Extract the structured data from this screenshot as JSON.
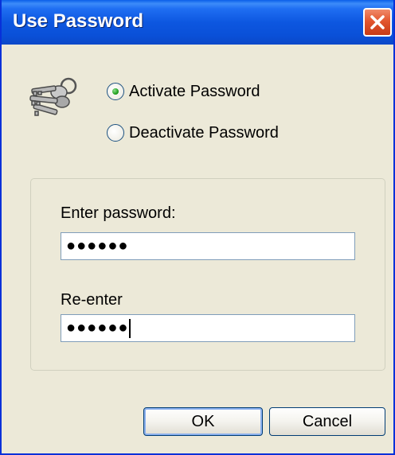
{
  "window": {
    "title": "Use Password"
  },
  "options": {
    "activate_label": "Activate Password",
    "deactivate_label": "Deactivate Password",
    "selected": "Activate Password"
  },
  "fields": {
    "enter_label": "Enter password:",
    "enter_value": "●●●●●●",
    "reenter_label": "Re-enter",
    "reenter_value": "●●●●●●"
  },
  "buttons": {
    "ok_label": "OK",
    "cancel_label": "Cancel"
  },
  "icons": {
    "title_close": "close-icon",
    "keys": "keys-icon"
  },
  "colors": {
    "titlebar": "#0a50d8",
    "close_button": "#e2562f",
    "dialog_background": "#ece9d8",
    "radio_checked": "#21a121"
  }
}
